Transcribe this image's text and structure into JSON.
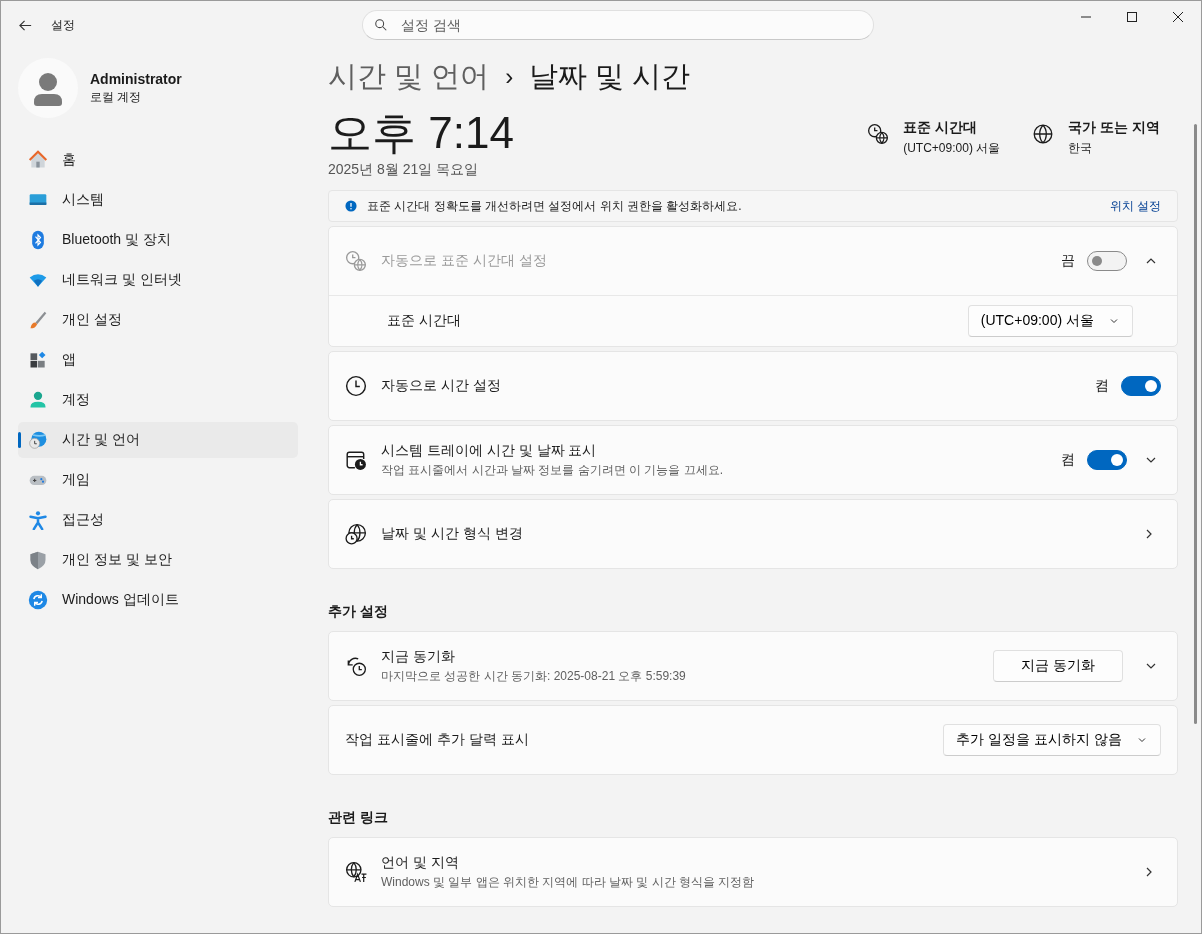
{
  "window": {
    "title": "설정",
    "search": {
      "placeholder": "설정 검색"
    }
  },
  "user": {
    "name": "Administrator",
    "account": "로컬 계정"
  },
  "nav": [
    {
      "label": "홈",
      "selected": false
    },
    {
      "label": "시스템",
      "selected": false
    },
    {
      "label": "Bluetooth 및 장치",
      "selected": false
    },
    {
      "label": "네트워크 및 인터넷",
      "selected": false
    },
    {
      "label": "개인 설정",
      "selected": false
    },
    {
      "label": "앱",
      "selected": false
    },
    {
      "label": "계정",
      "selected": false
    },
    {
      "label": "시간 및 언어",
      "selected": true
    },
    {
      "label": "게임",
      "selected": false
    },
    {
      "label": "접근성",
      "selected": false
    },
    {
      "label": "개인 정보 및 보안",
      "selected": false
    },
    {
      "label": "Windows 업데이트",
      "selected": false
    }
  ],
  "breadcrumb": {
    "parent": "시간 및 언어",
    "separator": "›",
    "current": "날짜 및 시간"
  },
  "clock": {
    "time": "오후 7:14",
    "date": "2025년 8월 21일 목요일"
  },
  "info": [
    {
      "title": "표준 시간대",
      "value": "(UTC+09:00) 서울"
    },
    {
      "title": "국가 또는 지역",
      "value": "한국"
    }
  ],
  "banner": {
    "text": "표준 시간대 정확도를 개선하려면 설정에서 위치 권한을 활성화하세요.",
    "link": "위치 설정"
  },
  "sections": [
    {
      "cards": [
        {
          "title": "자동으로 표준 시간대 설정",
          "disabled": true,
          "toggle": {
            "label": "끔",
            "on": false
          },
          "expanded": true,
          "children": [
            {
              "title": "표준 시간대",
              "dropdown": "(UTC+09:00) 서울"
            }
          ]
        },
        {
          "title": "자동으로 시간 설정",
          "disabled": false,
          "toggle": {
            "label": "켬",
            "on": true
          }
        },
        {
          "title": "시스템 트레이에 시간 및 날짜 표시",
          "subtitle": "작업 표시줄에서 시간과 날짜 정보를 숨기려면 이 기능을 끄세요.",
          "disabled": false,
          "toggle": {
            "label": "켬",
            "on": true
          },
          "expanded": false
        },
        {
          "title": "날짜 및 시간 형식 변경",
          "disabled": false,
          "link": true
        }
      ]
    },
    {
      "heading": "추가 설정",
      "cards": [
        {
          "title": "지금 동기화",
          "subtitle": "마지막으로 성공한 시간 동기화: 2025-08-21 오후 5:59:39",
          "disabled": false,
          "button": "지금 동기화",
          "expanded": false
        },
        {
          "title": "작업 표시줄에 추가 달력 표시",
          "disabled": false,
          "dropdown": "추가 일정을 표시하지 않음"
        }
      ]
    },
    {
      "heading": "관련 링크",
      "cards": [
        {
          "title": "언어 및 지역",
          "subtitle": "Windows 및 일부 앱은 위치한 지역에 따라 날짜 및 시간 형식을 지정함",
          "disabled": false,
          "link": true
        }
      ]
    }
  ]
}
